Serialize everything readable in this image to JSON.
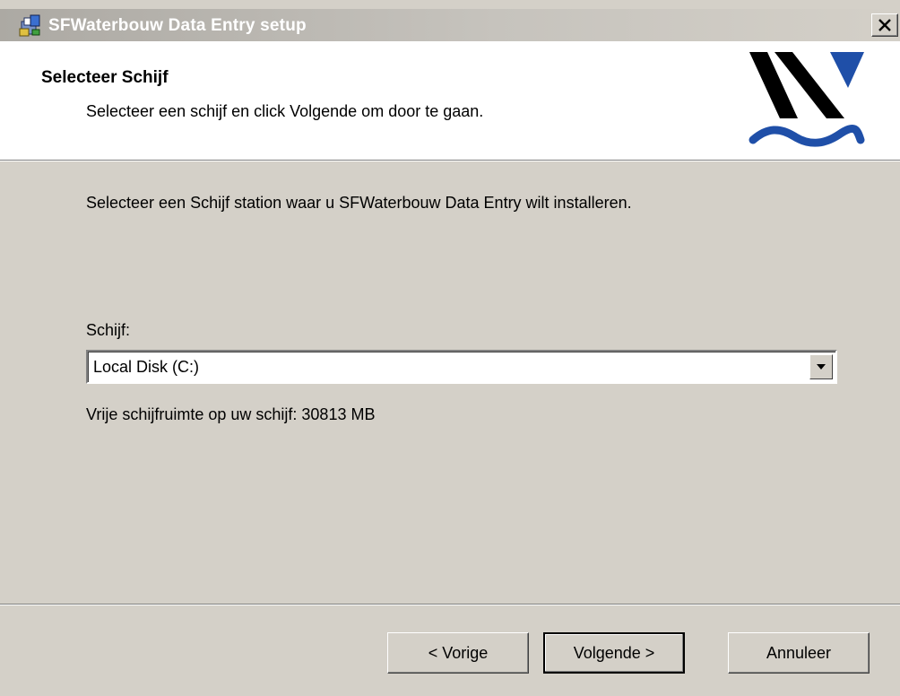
{
  "window": {
    "title": "SFWaterbouw Data Entry setup",
    "close_label": "×"
  },
  "header": {
    "title": "Selecteer Schijf",
    "subtitle": "Selecteer een schijf en click Volgende om door te gaan."
  },
  "body": {
    "instruction": "Selecteer een Schijf station waar u SFWaterbouw Data Entry wilt installeren.",
    "drive_label": "Schijf:",
    "drive_value": "Local Disk (C:)",
    "free_space": "Vrije schijfruimte op uw schijf: 30813 MB"
  },
  "buttons": {
    "back": "< Vorige",
    "next": "Volgende >",
    "cancel": "Annuleer"
  },
  "icons": {
    "app": "installer-icon",
    "logo": "waterbouw-logo",
    "close": "close-icon",
    "dropdown": "chevron-down-icon"
  },
  "colors": {
    "dialog_bg": "#d4d0c8",
    "banner_bg": "#ffffff",
    "logo_dark": "#000000",
    "logo_blue": "#1f4fa8"
  }
}
